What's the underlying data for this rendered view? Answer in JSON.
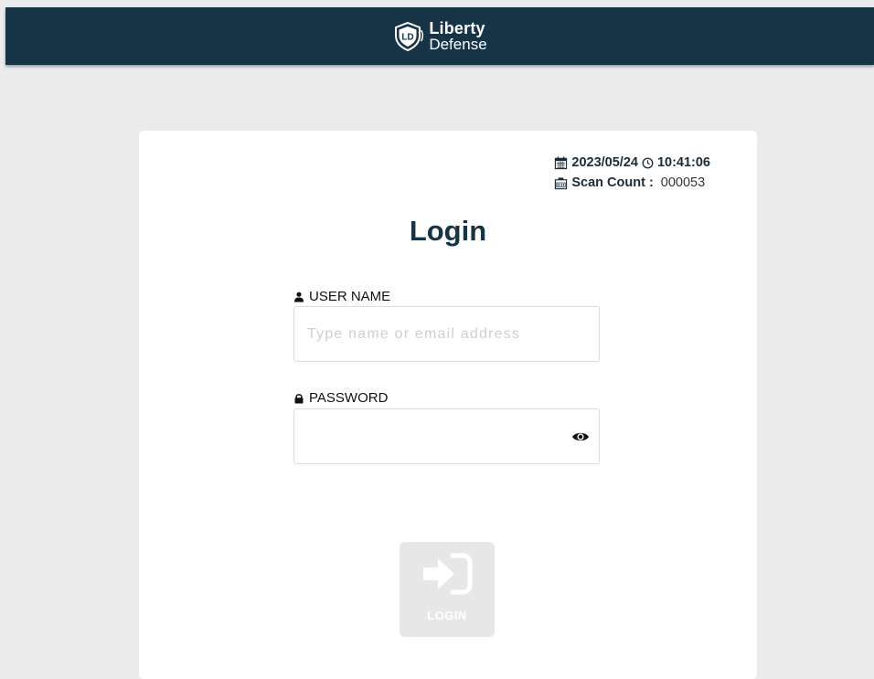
{
  "brand": {
    "line1": "Liberty",
    "line2": "Defense",
    "logo_text": "LD",
    "logo_icon": "shield-logo"
  },
  "meta": {
    "date": "2023/05/24",
    "time": "10:41:06",
    "scan_count_label": "Scan Count :",
    "scan_count_value": "000053",
    "date_icon": "calendar-icon",
    "time_icon": "clock-icon",
    "count_icon": "counter-icon"
  },
  "login": {
    "title": "Login",
    "username_label": "USER NAME",
    "username_placeholder": "Type name or email address",
    "username_value": "",
    "password_label": "PASSWORD",
    "password_value": "",
    "button_label": "LOGIN",
    "user_icon": "user-icon",
    "lock_icon": "lock-icon",
    "eye_icon": "eye-icon",
    "button_icon": "sign-in-icon"
  },
  "colors": {
    "topbar": "#173446",
    "background": "#ebebeb",
    "card": "#ffffff",
    "title": "#173446",
    "button_disabled": "#e7e7e7"
  }
}
